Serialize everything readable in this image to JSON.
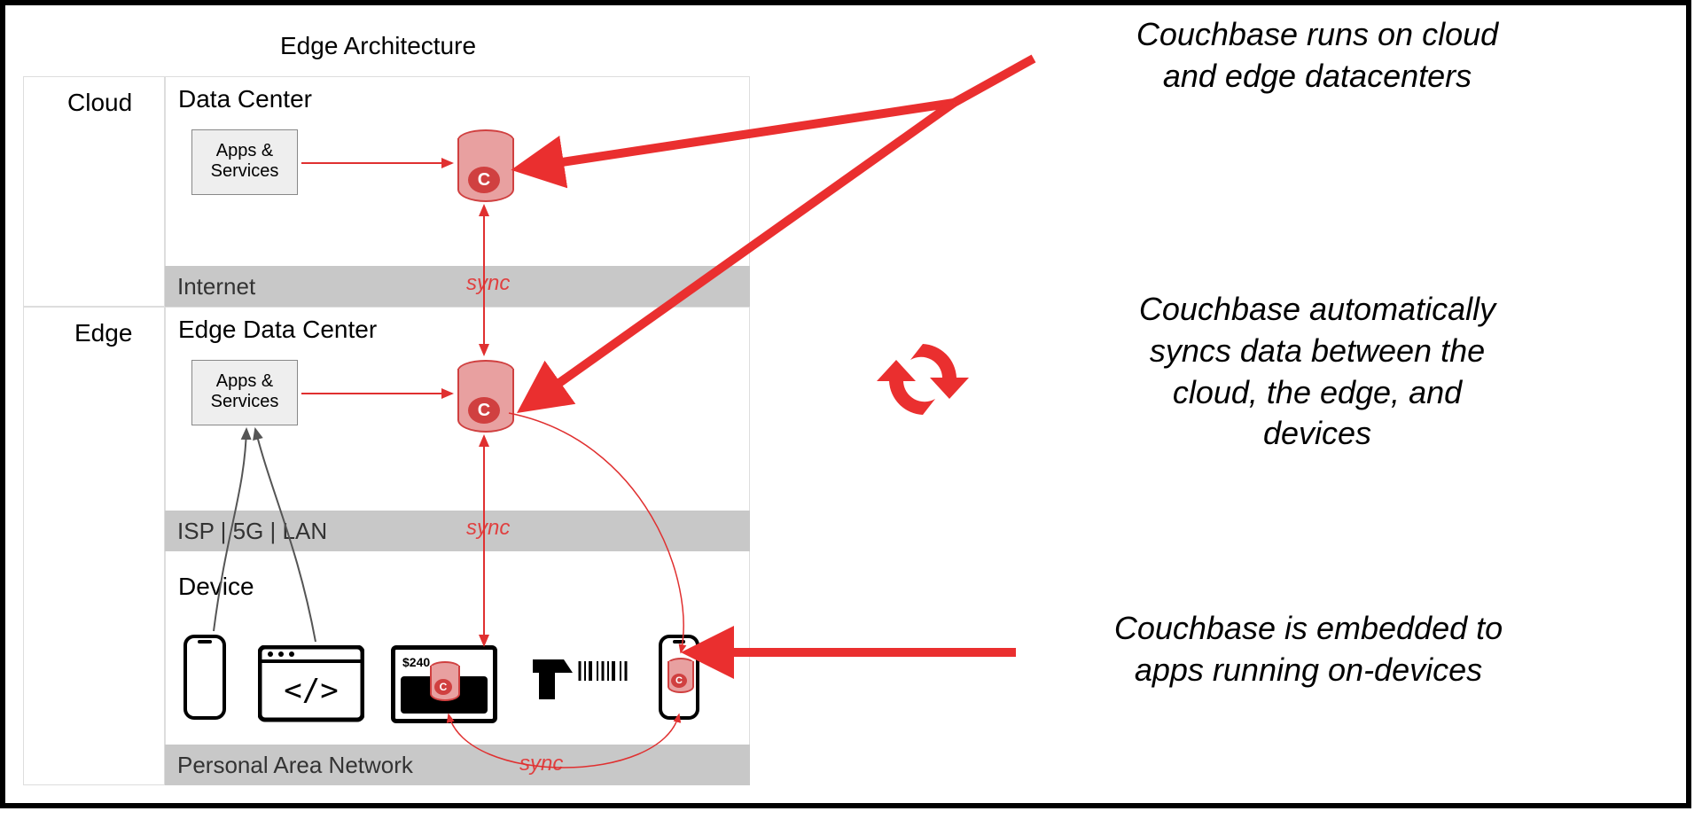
{
  "title": "Edge Architecture",
  "left": {
    "cloud": "Cloud",
    "edge": "Edge",
    "data_center": "Data Center",
    "edge_data_center": "Edge Data Center",
    "device": "Device",
    "apps": "Apps & Services",
    "internet": "Internet",
    "isp": "ISP | 5G | LAN",
    "pan": "Personal Area Network",
    "sync": "sync",
    "pay_amount": "$240"
  },
  "annotations": {
    "a1_l1": "Couchbase runs on cloud",
    "a1_l2": "and edge datacenters",
    "a2_l1": "Couchbase automatically",
    "a2_l2": "syncs data between the",
    "a2_l3": "cloud, the edge, and",
    "a2_l4": "devices",
    "a3_l1": "Couchbase is embedded to",
    "a3_l2": "apps running on-devices"
  },
  "colors": {
    "arrow_red": "#ea2f2f",
    "thin_red": "#e03030"
  }
}
